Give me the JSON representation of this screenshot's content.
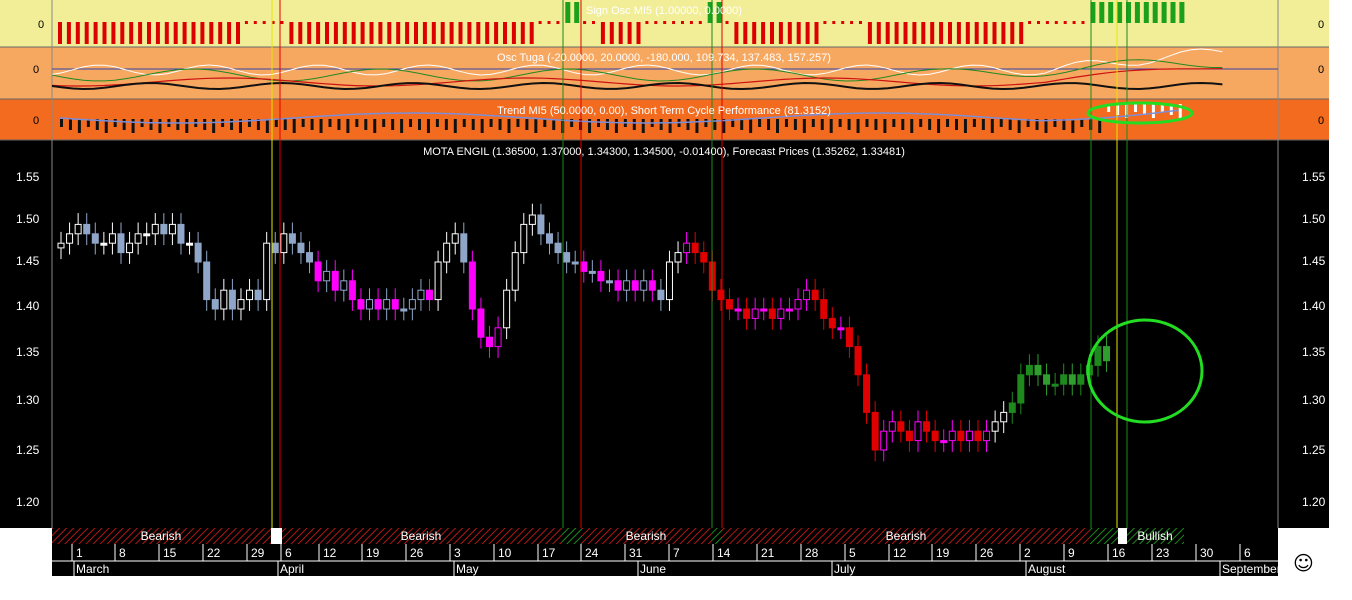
{
  "panels": {
    "sign_osc": {
      "title": "Sign Osc MI5 (1.00000, 0.0000)",
      "bg": "#f2ee98",
      "zero_label": "0"
    },
    "osc_tuga": {
      "title": "Osc Tuga (-20.0000, 20.0000, -180.000, 109.734, 137.483, 157.257)",
      "bg": "#f7a860",
      "zero_label": "0"
    },
    "trend": {
      "title": "Trend MI5 (50.0000, 0.00), Short Term Cycle Performance (81.3152)",
      "bg": "#f36b1e",
      "zero_label": "0"
    }
  },
  "main_title": "MOTA ENGIL (1.36500, 1.37000, 1.34300, 1.34500, -0.01400), Forecast Prices (1.35262, 1.33481)",
  "y_ticks": [
    "1.55",
    "1.50",
    "1.45",
    "1.40",
    "1.35",
    "1.30",
    "1.25",
    "1.20"
  ],
  "regime_labels": [
    "Bearish",
    "Bearish",
    "Bearish",
    "Bearish",
    "Bullish"
  ],
  "day_ticks": [
    "1",
    "8",
    "15",
    "22",
    "29",
    "6",
    "12",
    "19",
    "26",
    "3",
    "10",
    "17",
    "24",
    "31",
    "7",
    "14",
    "21",
    "28",
    "5",
    "12",
    "19",
    "26",
    "2",
    "9",
    "16",
    "23",
    "30",
    "6"
  ],
  "month_labels": [
    "March",
    "April",
    "May",
    "June",
    "July",
    "August",
    "September"
  ],
  "colors": {
    "bull": "#ffffff",
    "bear": "#e00000",
    "magenta": "#ff00ff",
    "steel": "#8fa6c8",
    "green": "#1e8a1e",
    "highlight": "#22dd22"
  },
  "chart_data": {
    "type": "candlestick",
    "title": "MOTA ENGIL (1.36500, 1.37000, 1.34300, 1.34500, -0.01400), Forecast Prices (1.35262, 1.33481)",
    "ylim": [
      1.17,
      1.575
    ],
    "last_bar": {
      "open": 1.365,
      "high": 1.37,
      "low": 1.343,
      "close": 1.345,
      "change": -0.014
    },
    "forecast_prices": [
      1.35262,
      1.33481
    ],
    "short_term_cycle_performance": 81.3152,
    "closes": [
      1.47,
      1.48,
      1.49,
      1.48,
      1.47,
      1.47,
      1.48,
      1.46,
      1.47,
      1.48,
      1.48,
      1.49,
      1.48,
      1.49,
      1.47,
      1.47,
      1.45,
      1.41,
      1.4,
      1.42,
      1.4,
      1.41,
      1.42,
      1.41,
      1.47,
      1.46,
      1.48,
      1.47,
      1.46,
      1.45,
      1.43,
      1.44,
      1.42,
      1.43,
      1.41,
      1.4,
      1.41,
      1.4,
      1.41,
      1.4,
      1.4,
      1.41,
      1.42,
      1.41,
      1.45,
      1.47,
      1.48,
      1.45,
      1.4,
      1.37,
      1.36,
      1.38,
      1.42,
      1.46,
      1.49,
      1.5,
      1.48,
      1.47,
      1.46,
      1.45,
      1.45,
      1.44,
      1.44,
      1.43,
      1.43,
      1.42,
      1.43,
      1.42,
      1.43,
      1.42,
      1.41,
      1.45,
      1.46,
      1.47,
      1.46,
      1.45,
      1.42,
      1.41,
      1.4,
      1.4,
      1.39,
      1.4,
      1.4,
      1.39,
      1.4,
      1.4,
      1.41,
      1.42,
      1.41,
      1.39,
      1.38,
      1.38,
      1.36,
      1.33,
      1.29,
      1.25,
      1.27,
      1.28,
      1.27,
      1.26,
      1.28,
      1.27,
      1.26,
      1.26,
      1.27,
      1.26,
      1.27,
      1.26,
      1.27,
      1.28,
      1.29,
      1.3,
      1.33,
      1.34,
      1.33,
      1.32,
      1.32,
      1.33,
      1.32,
      1.33,
      1.34,
      1.36,
      1.345
    ]
  }
}
